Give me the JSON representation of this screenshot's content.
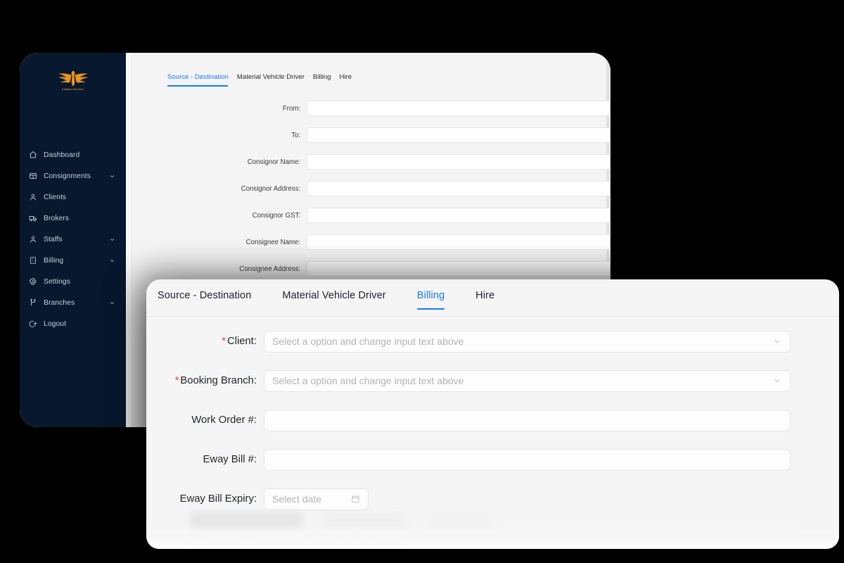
{
  "app": {
    "logo_text": "Chawla Carriers",
    "logo_icon": "eagle-logo-icon",
    "brand_color": "#e0922a",
    "sidebar_bg": "#08182e",
    "accent_color": "#1677ff",
    "required_color": "#e04141"
  },
  "sidebar": {
    "items": [
      {
        "label": "Dashboard",
        "icon": "home-icon",
        "expandable": false
      },
      {
        "label": "Consignments",
        "icon": "grid-table-icon",
        "expandable": true
      },
      {
        "label": "Clients",
        "icon": "user-icon",
        "expandable": false
      },
      {
        "label": "Brokers",
        "icon": "truck-icon",
        "expandable": true
      },
      {
        "label": "Staffs",
        "icon": "user-icon",
        "expandable": true
      },
      {
        "label": "Billing",
        "icon": "building-icon",
        "expandable": true
      },
      {
        "label": "Settings",
        "icon": "gear-icon",
        "expandable": false
      },
      {
        "label": "Branches",
        "icon": "branch-icon",
        "expandable": true
      },
      {
        "label": "Logout",
        "icon": "logout-icon",
        "expandable": false
      }
    ]
  },
  "back_window": {
    "tabs": [
      {
        "label": "Source - Destination",
        "active": true
      },
      {
        "label": "Material Vehicle Driver",
        "active": false
      },
      {
        "label": "Billing",
        "active": false
      },
      {
        "label": "Hire",
        "active": false
      }
    ],
    "fields": [
      {
        "label": "From:",
        "value": ""
      },
      {
        "label": "To:",
        "value": ""
      },
      {
        "label": "Consignor Name:",
        "value": ""
      },
      {
        "label": "Consignor Address:",
        "value": ""
      },
      {
        "label": "Consignor GST:",
        "value": ""
      },
      {
        "label": "Consignee Name:",
        "value": ""
      },
      {
        "label": "Consignee Address:",
        "value": ""
      }
    ]
  },
  "front_window": {
    "tabs": [
      {
        "label": "Source - Destination",
        "active": false
      },
      {
        "label": "Material Vehicle Driver",
        "active": false
      },
      {
        "label": "Billing",
        "active": true
      },
      {
        "label": "Hire",
        "active": false
      }
    ],
    "fields": [
      {
        "label": "Client:",
        "required": true,
        "type": "select",
        "placeholder": "Select a option and change input text above",
        "value": "",
        "icon": "chevron-down-icon"
      },
      {
        "label": "Booking Branch:",
        "required": true,
        "type": "select",
        "placeholder": "Select a option and change input text above",
        "value": "",
        "icon": "chevron-down-icon"
      },
      {
        "label": "Work Order #:",
        "required": false,
        "type": "text",
        "placeholder": "",
        "value": "",
        "icon": ""
      },
      {
        "label": "Eway Bill #:",
        "required": false,
        "type": "text",
        "placeholder": "",
        "value": "",
        "icon": ""
      },
      {
        "label": "Eway Bill Expiry:",
        "required": false,
        "type": "date",
        "placeholder": "Select date",
        "value": "",
        "icon": "calendar-icon"
      }
    ]
  }
}
